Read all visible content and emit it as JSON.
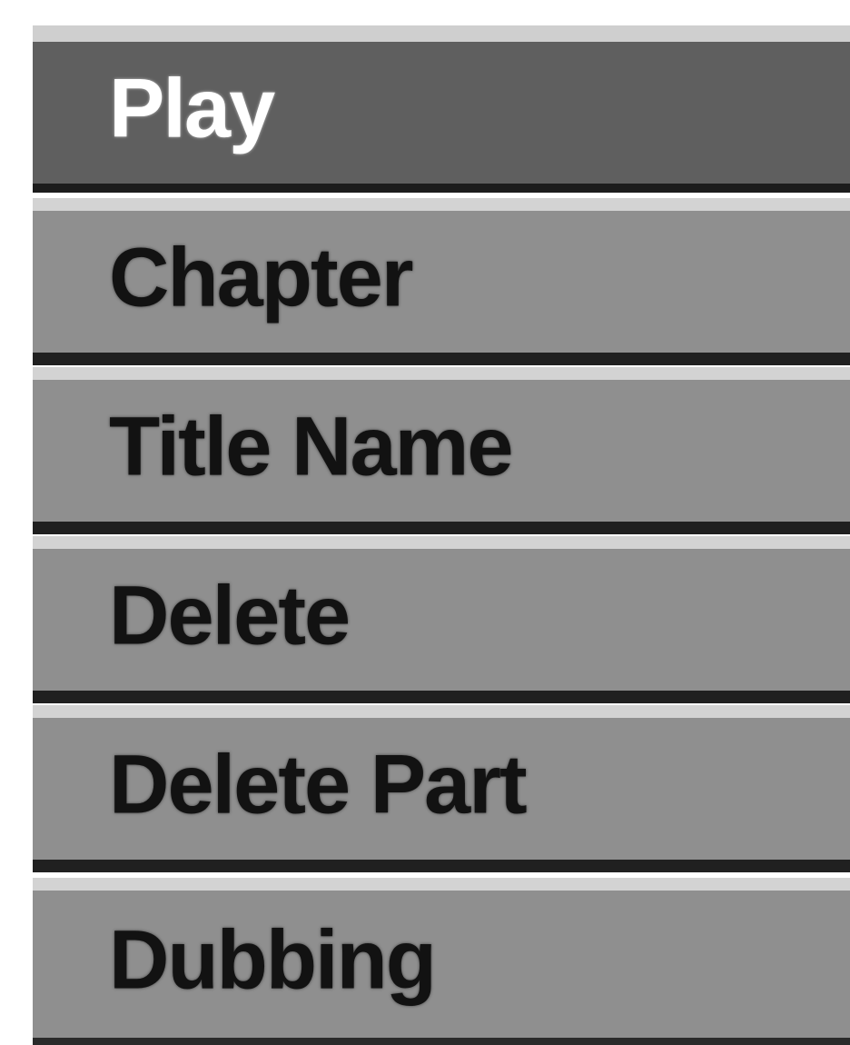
{
  "menu": {
    "selected_index": 0,
    "items": [
      {
        "label": "Play"
      },
      {
        "label": "Chapter"
      },
      {
        "label": "Title Name"
      },
      {
        "label": "Delete"
      },
      {
        "label": "Delete Part"
      },
      {
        "label": "Dubbing"
      }
    ]
  },
  "colors": {
    "item_background": "#8f8f8f",
    "selected_background": "#5f5f5f",
    "item_text": "#121212",
    "selected_text": "#ffffff"
  }
}
